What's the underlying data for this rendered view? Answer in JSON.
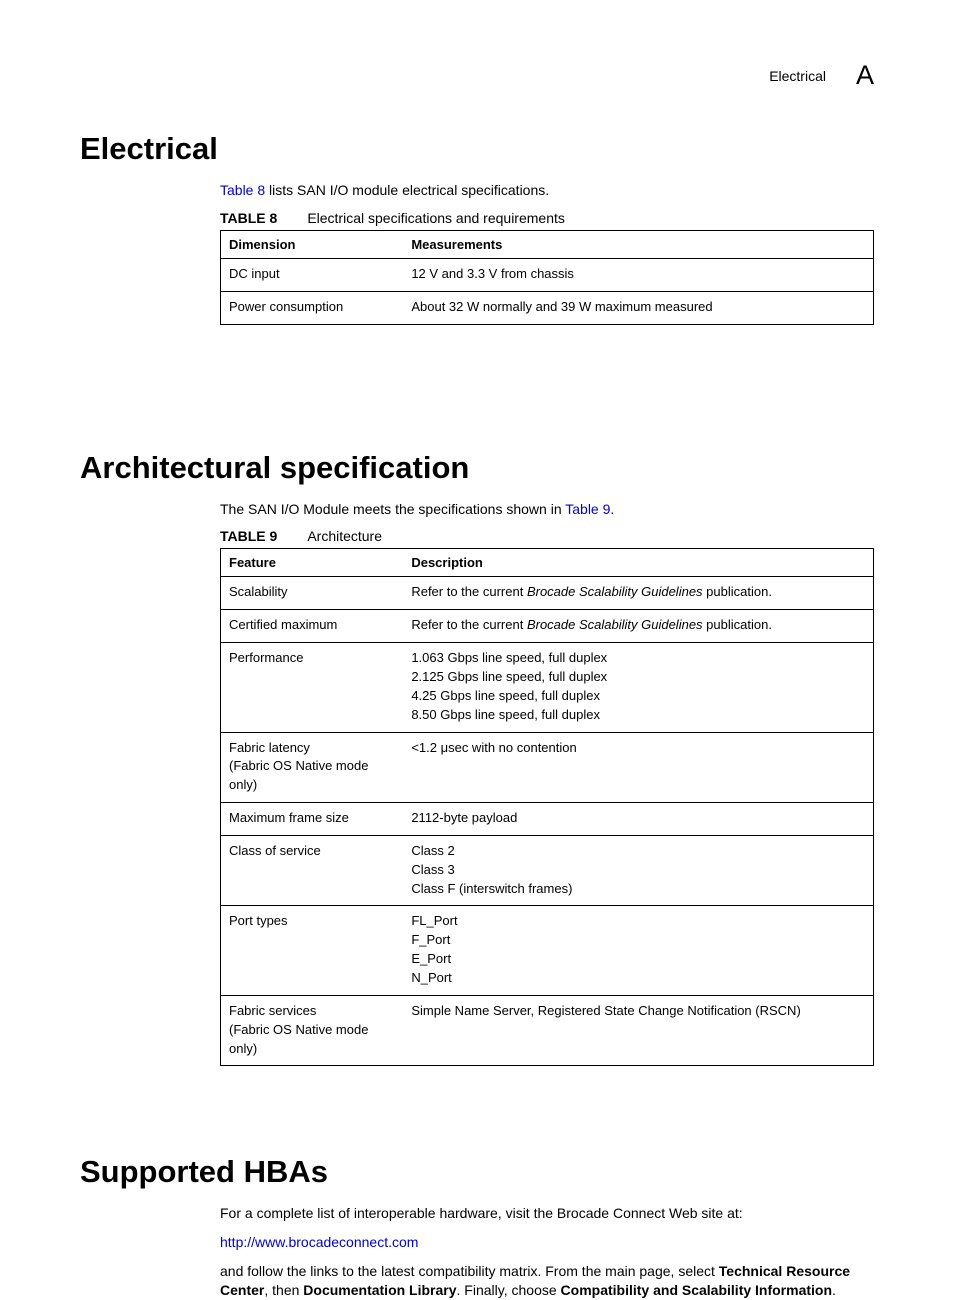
{
  "header": {
    "section_label": "Electrical",
    "appendix_letter": "A"
  },
  "sections": {
    "electrical": {
      "title": "Electrical",
      "intro_link": "Table 8",
      "intro_rest": " lists SAN I/O module electrical specifications.",
      "table_label": "TABLE 8",
      "table_caption": "Electrical specifications and requirements",
      "th1": "Dimension",
      "th2": "Measurements",
      "rows": [
        {
          "c1": "DC input",
          "c2": "12 V and 3.3 V from chassis"
        },
        {
          "c1": "Power consumption",
          "c2": "About 32 W normally and 39 W maximum measured"
        }
      ]
    },
    "arch": {
      "title": "Architectural specification",
      "intro_pre": "The SAN I/O Module meets the specifications shown in ",
      "intro_link": "Table 9",
      "intro_post": ".",
      "table_label": "TABLE 9",
      "table_caption": "Architecture",
      "th1": "Feature",
      "th2": "Description",
      "rows": [
        {
          "c1": "Scalability",
          "c2_pre": "Refer to the current ",
          "c2_em": "Brocade Scalability Guidelines",
          "c2_post": " publication."
        },
        {
          "c1": "Certified maximum",
          "c2_pre": "Refer to the current ",
          "c2_em": "Brocade Scalability Guidelines",
          "c2_post": " publication."
        },
        {
          "c1": "Performance",
          "c2": "1.063 Gbps line speed, full duplex\n2.125 Gbps line speed, full duplex\n4.25 Gbps line speed, full duplex\n8.50 Gbps line speed, full duplex"
        },
        {
          "c1": "Fabric latency\n(Fabric OS Native mode only)",
          "c2": "<1.2 μsec with no contention"
        },
        {
          "c1": "Maximum frame size",
          "c2": "2112-byte payload"
        },
        {
          "c1": "Class of service",
          "c2": "Class 2\nClass 3\nClass F (interswitch frames)"
        },
        {
          "c1": "Port types",
          "c2": "FL_Port\nF_Port\nE_Port\nN_Port"
        },
        {
          "c1": "Fabric services\n(Fabric OS Native mode only)",
          "c2": "Simple Name Server, Registered State Change Notification (RSCN)"
        }
      ]
    },
    "hba": {
      "title": "Supported HBAs",
      "p1": "For a complete list of interoperable hardware, visit the Brocade Connect Web site at:",
      "link": "http://www.brocadeconnect.com",
      "p2_pre": "and follow the links to the latest compatibility matrix. From the main page, select ",
      "p2_b1": "Technical Resource Center",
      "p2_m1": ", then ",
      "p2_b2": "Documentation Library",
      "p2_m2": ". Finally, choose ",
      "p2_b3": "Compatibility and Scalability Information",
      "p2_post": "."
    }
  }
}
